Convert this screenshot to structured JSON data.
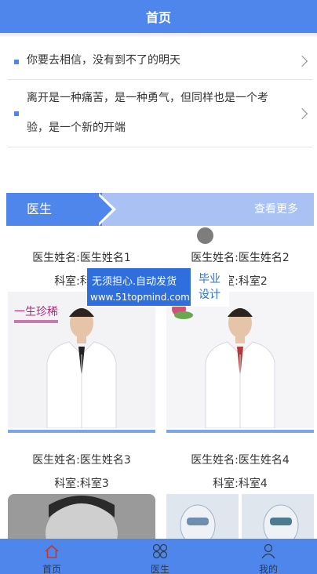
{
  "header": {
    "title": "首页"
  },
  "notices": [
    {
      "text": "你要去相信，没有到不了的明天"
    },
    {
      "line1": "离开是一种痛苦，是一种勇气，但同样也是一个考",
      "line2": "验，是一个新的开端"
    }
  ],
  "section": {
    "title": "医生",
    "more": "查看更多"
  },
  "doctors": [
    {
      "name": "医生姓名:医生姓名1",
      "dept": "科室:科室1"
    },
    {
      "name": "医生姓名:医生姓名2",
      "dept": "科室:科室2"
    },
    {
      "name": "医生姓名:医生姓名3",
      "dept": "科室:科室3"
    },
    {
      "name": "医生姓名:医生姓名4",
      "dept": "科室:科室4"
    }
  ],
  "watermark": {
    "line1": "无须担心.自动发货",
    "line2": "www.51topmind.com",
    "badge1": "毕业",
    "badge2": "设计"
  },
  "logo1": "一生珍稀",
  "tabbar": [
    {
      "label": "首页",
      "icon": "home-icon"
    },
    {
      "label": "医生",
      "icon": "grid-icon"
    },
    {
      "label": "我的",
      "icon": "user-icon"
    }
  ],
  "colors": {
    "primary": "#4f86ec",
    "banner_light": "#a9c2f3",
    "text": "#333333"
  }
}
